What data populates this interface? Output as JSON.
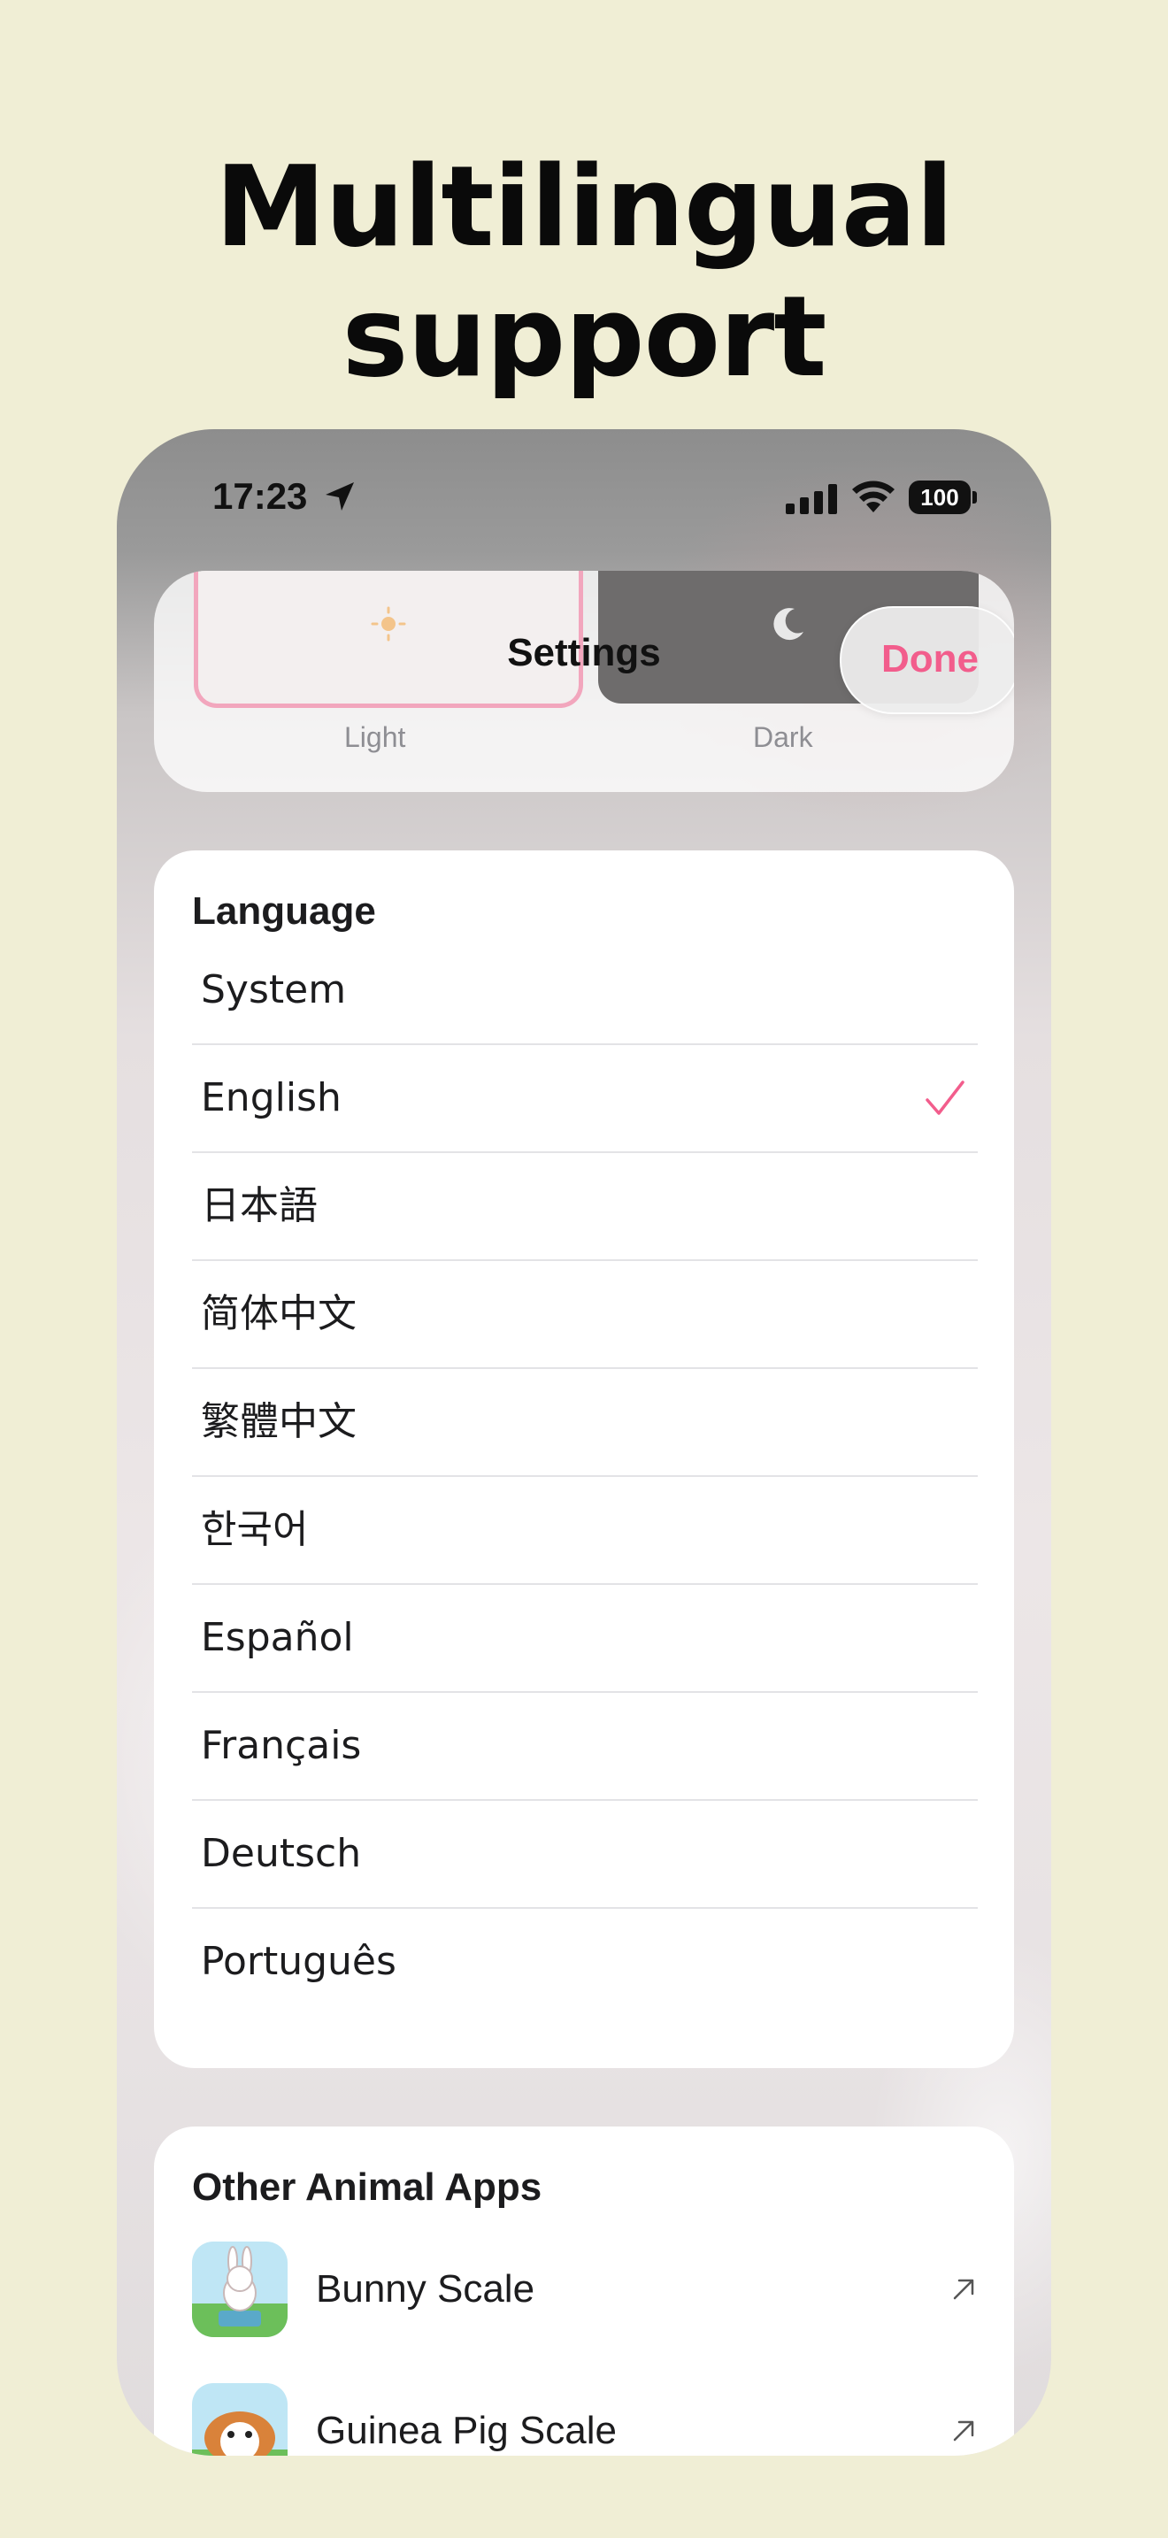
{
  "headline": "Multilingual support",
  "status_bar": {
    "time": "17:23",
    "battery": "100",
    "icons": [
      "location-arrow-icon",
      "cellular-signal-icon",
      "wifi-icon",
      "battery-icon"
    ]
  },
  "theme": {
    "light_label": "Light",
    "dark_label": "Dark",
    "selected": "Light",
    "accent": "#f2a6bd"
  },
  "nav": {
    "title": "Settings",
    "done_label": "Done",
    "accent": "#f25d8c"
  },
  "language": {
    "title": "Language",
    "selected": "English",
    "options": [
      {
        "label": "System"
      },
      {
        "label": "English"
      },
      {
        "label": "日本語"
      },
      {
        "label": "简体中文"
      },
      {
        "label": "繁體中文"
      },
      {
        "label": "한국어"
      },
      {
        "label": "Español"
      },
      {
        "label": "Français"
      },
      {
        "label": "Deutsch"
      },
      {
        "label": "Português"
      }
    ]
  },
  "other_apps": {
    "title": "Other Animal Apps",
    "items": [
      {
        "label": "Bunny Scale",
        "icon": "bunny-app-icon"
      },
      {
        "label": "Guinea Pig Scale",
        "icon": "guinea-pig-app-icon"
      }
    ]
  }
}
